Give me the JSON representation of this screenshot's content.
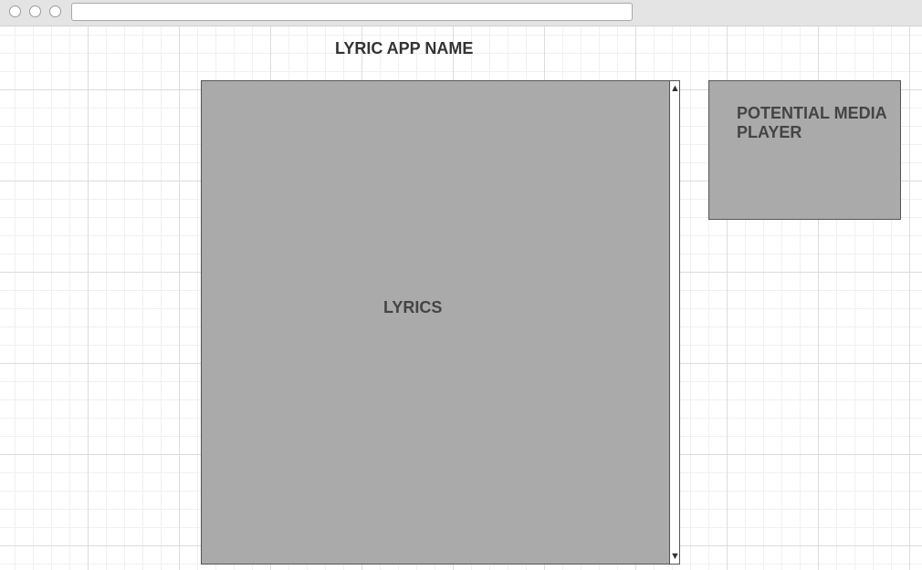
{
  "header": {
    "app_title": "LYRIC APP NAME"
  },
  "lyrics": {
    "label": "LYRICS",
    "scroll_up_icon": "▲",
    "scroll_down_icon": "▼"
  },
  "media_player": {
    "label": "POTENTIAL MEDIA PLAYER"
  },
  "window": {
    "controls": [
      "close-button",
      "minimize-button",
      "maximize-button"
    ]
  },
  "colors": {
    "panel_fill": "#aaaaaa",
    "panel_border": "#555555",
    "text": "#444444"
  }
}
